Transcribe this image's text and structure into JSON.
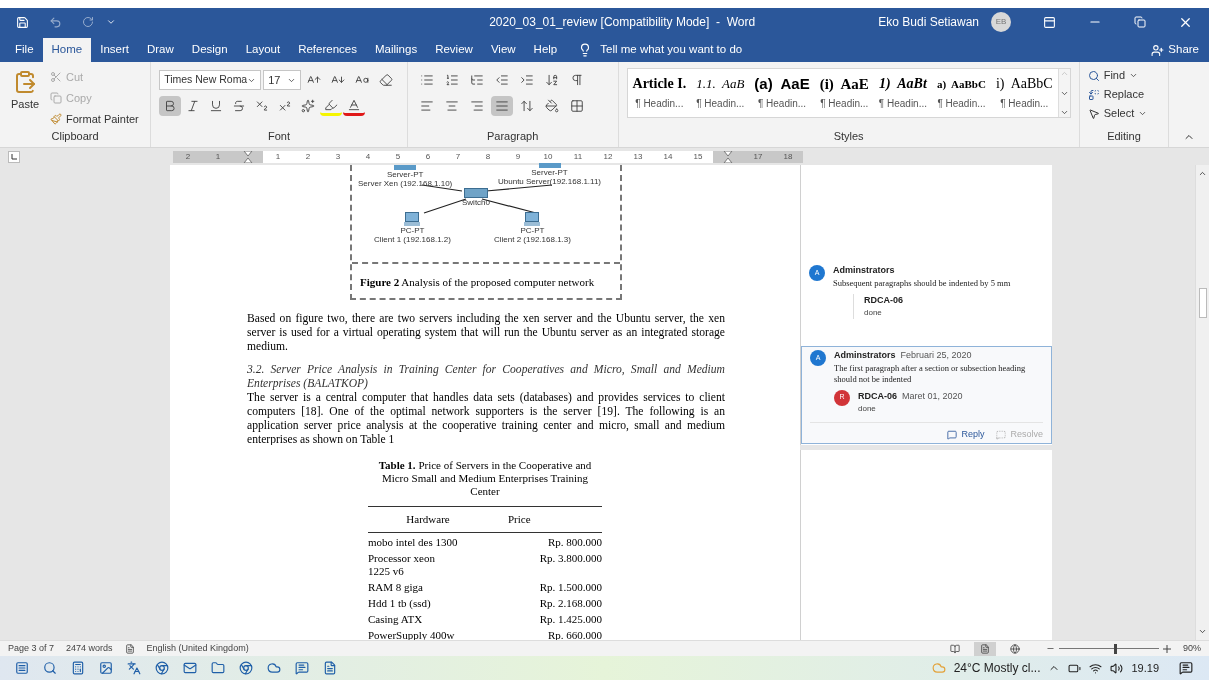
{
  "window": {
    "title": "2020_03_01_review [Compatibility Mode]  -  Word",
    "user": "Eko Budi Setiawan",
    "user_initials": "EB"
  },
  "ribbon_tabs": [
    {
      "label": "File",
      "selected": false
    },
    {
      "label": "Home",
      "selected": true
    },
    {
      "label": "Insert",
      "selected": false
    },
    {
      "label": "Draw",
      "selected": false
    },
    {
      "label": "Design",
      "selected": false
    },
    {
      "label": "Layout",
      "selected": false
    },
    {
      "label": "References",
      "selected": false
    },
    {
      "label": "Mailings",
      "selected": false
    },
    {
      "label": "Review",
      "selected": false
    },
    {
      "label": "View",
      "selected": false
    },
    {
      "label": "Help",
      "selected": false
    }
  ],
  "tell_me": "Tell me what you want to do",
  "share": "Share",
  "clipboard": {
    "paste": "Paste",
    "group": "Clipboard",
    "items": [
      {
        "kind": "cut",
        "label": "Cut",
        "disabled": true
      },
      {
        "kind": "copy",
        "label": "Copy",
        "disabled": true
      },
      {
        "kind": "painter",
        "label": "Format Painter",
        "disabled": false
      }
    ]
  },
  "font": {
    "name": "Times New Roma",
    "size": "17",
    "bold_selected": true,
    "group": "Font"
  },
  "paragraph": {
    "justify_selected": true,
    "group": "Paragraph"
  },
  "styles": {
    "group": "Styles",
    "items": [
      {
        "kind": "article",
        "preview": "Article I.",
        "label": "¶ Headin..."
      },
      {
        "kind": "italic",
        "preview": "1.1.  AaB",
        "label": "¶ Headin..."
      },
      {
        "kind": "sans",
        "preview": "(a)  AaE",
        "label": "¶ Headin..."
      },
      {
        "kind": "serifbold",
        "preview": "(i)  AaE",
        "label": "¶ Headin..."
      },
      {
        "kind": "bolditalic",
        "preview": "1)  AaBt",
        "label": "¶ Headin..."
      },
      {
        "kind": "small",
        "preview": "a)  AaBbC",
        "label": "¶ Headin..."
      },
      {
        "kind": "plain",
        "preview": "i)  AaBbC",
        "label": "¶ Headin..."
      }
    ]
  },
  "editing": {
    "group": "Editing",
    "find": "Find",
    "replace": "Replace",
    "select": "Select"
  },
  "ruler": [
    {
      "kind": "number",
      "label": "2",
      "margin": true
    },
    {
      "kind": "number",
      "label": "1",
      "margin": true
    },
    {
      "kind": "marker",
      "margin": true
    },
    {
      "kind": "number",
      "label": "1",
      "margin": false
    },
    {
      "kind": "number",
      "label": "2",
      "margin": false
    },
    {
      "kind": "number",
      "label": "3",
      "margin": false
    },
    {
      "kind": "number",
      "label": "4",
      "margin": false
    },
    {
      "kind": "number",
      "label": "5",
      "margin": false
    },
    {
      "kind": "number",
      "label": "6",
      "margin": false
    },
    {
      "kind": "number",
      "label": "7",
      "margin": false
    },
    {
      "kind": "number",
      "label": "8",
      "margin": false
    },
    {
      "kind": "number",
      "label": "9",
      "margin": false
    },
    {
      "kind": "number",
      "label": "10",
      "margin": false
    },
    {
      "kind": "number",
      "label": "11",
      "margin": false
    },
    {
      "kind": "number",
      "label": "12",
      "margin": false
    },
    {
      "kind": "number",
      "label": "13",
      "margin": false
    },
    {
      "kind": "number",
      "label": "14",
      "margin": false
    },
    {
      "kind": "number",
      "label": "15",
      "margin": false
    },
    {
      "kind": "marker",
      "margin": true
    },
    {
      "kind": "number",
      "label": "17",
      "margin": true
    },
    {
      "kind": "number",
      "label": "18",
      "margin": true
    }
  ],
  "figure": {
    "nodes": [
      {
        "kind": "server",
        "type": "Server-PT",
        "name": "Server Xen (192.168.1.10)"
      },
      {
        "kind": "server",
        "type": "Server-PT",
        "name": "Ubuntu Server(192.168.1.11)"
      },
      {
        "kind": "switch",
        "name": "Switch0"
      },
      {
        "kind": "pc",
        "type": "PC-PT",
        "name": "Client 1 (192.168.1.2)"
      },
      {
        "kind": "pc",
        "type": "PC-PT",
        "name": "Client 2 (192.168.1.3)"
      }
    ],
    "caption": "**Figure 2** Analysis of the proposed computer network"
  },
  "body": [
    {
      "kind": "paragraph",
      "text": "Based on figure two, there are two servers including the xen server and the Ubuntu server, the xen server is used for a virtual operating system that will run the Ubuntu server as an integrated storage medium."
    },
    {
      "kind": "heading",
      "text": "3.2. Server Price Analysis in Training Center for Cooperatives and Micro, Small and Medium Enterprises (BALATKOP)"
    },
    {
      "kind": "paragraph",
      "text": "The server is a central computer that handles data sets (databases) and provides services to client computers [18]. One of the optimal network supporters is the server [19]. The following is an application server price analysis at the cooperative training center and micro, small and medium enterprises as shown on Table 1"
    }
  ],
  "table": {
    "caption": "**Table 1.** Price of Servers in the Cooperative and Micro Small and Medium Enterprises Training Center",
    "columns": [
      "Hardware",
      "Price"
    ],
    "rows": [
      [
        "mobo intel des 1300",
        "Rp. 800.000"
      ],
      [
        "Processor xeon 1225 v6",
        "Rp. 3.800.000"
      ],
      [
        "RAM 8 giga",
        "Rp. 1.500.000"
      ],
      [
        "Hdd 1 tb (ssd)",
        "Rp. 2.168.000"
      ],
      [
        "Casing ATX",
        "Rp. 1.425.000"
      ],
      [
        "PowerSupply 400w",
        "Rp. 660.000"
      ]
    ]
  },
  "comments": [
    {
      "selected": false,
      "author": "Adminstrators",
      "initial": "A",
      "text": "Subsequent paragraphs should be indented by 5 mm",
      "replies": [
        {
          "author": "RDCA-06",
          "text": "done"
        }
      ]
    },
    {
      "selected": true,
      "author": "Adminstrators",
      "initial": "A",
      "date": "Februari 25, 2020",
      "text": "The first paragraph after a section or subsection heading should not be indented",
      "replies": [
        {
          "author": "RDCA-06",
          "initial": "R",
          "date": "Maret 01, 2020",
          "text": "done"
        }
      ],
      "reply": "Reply",
      "resolve": "Resolve"
    }
  ],
  "status_bar": {
    "page": "Page 3 of 7",
    "words": "2474 words",
    "language": "English (United Kingdom)",
    "views": [
      {
        "kind": "read",
        "selected": false
      },
      {
        "kind": "print",
        "selected": true
      },
      {
        "kind": "web",
        "selected": false
      }
    ],
    "zoom_slider": {
      "level": 0.55
    },
    "zoom": "90%"
  },
  "taskbar": {
    "weather": "24°C Mostly cl...",
    "time": "19.19"
  }
}
